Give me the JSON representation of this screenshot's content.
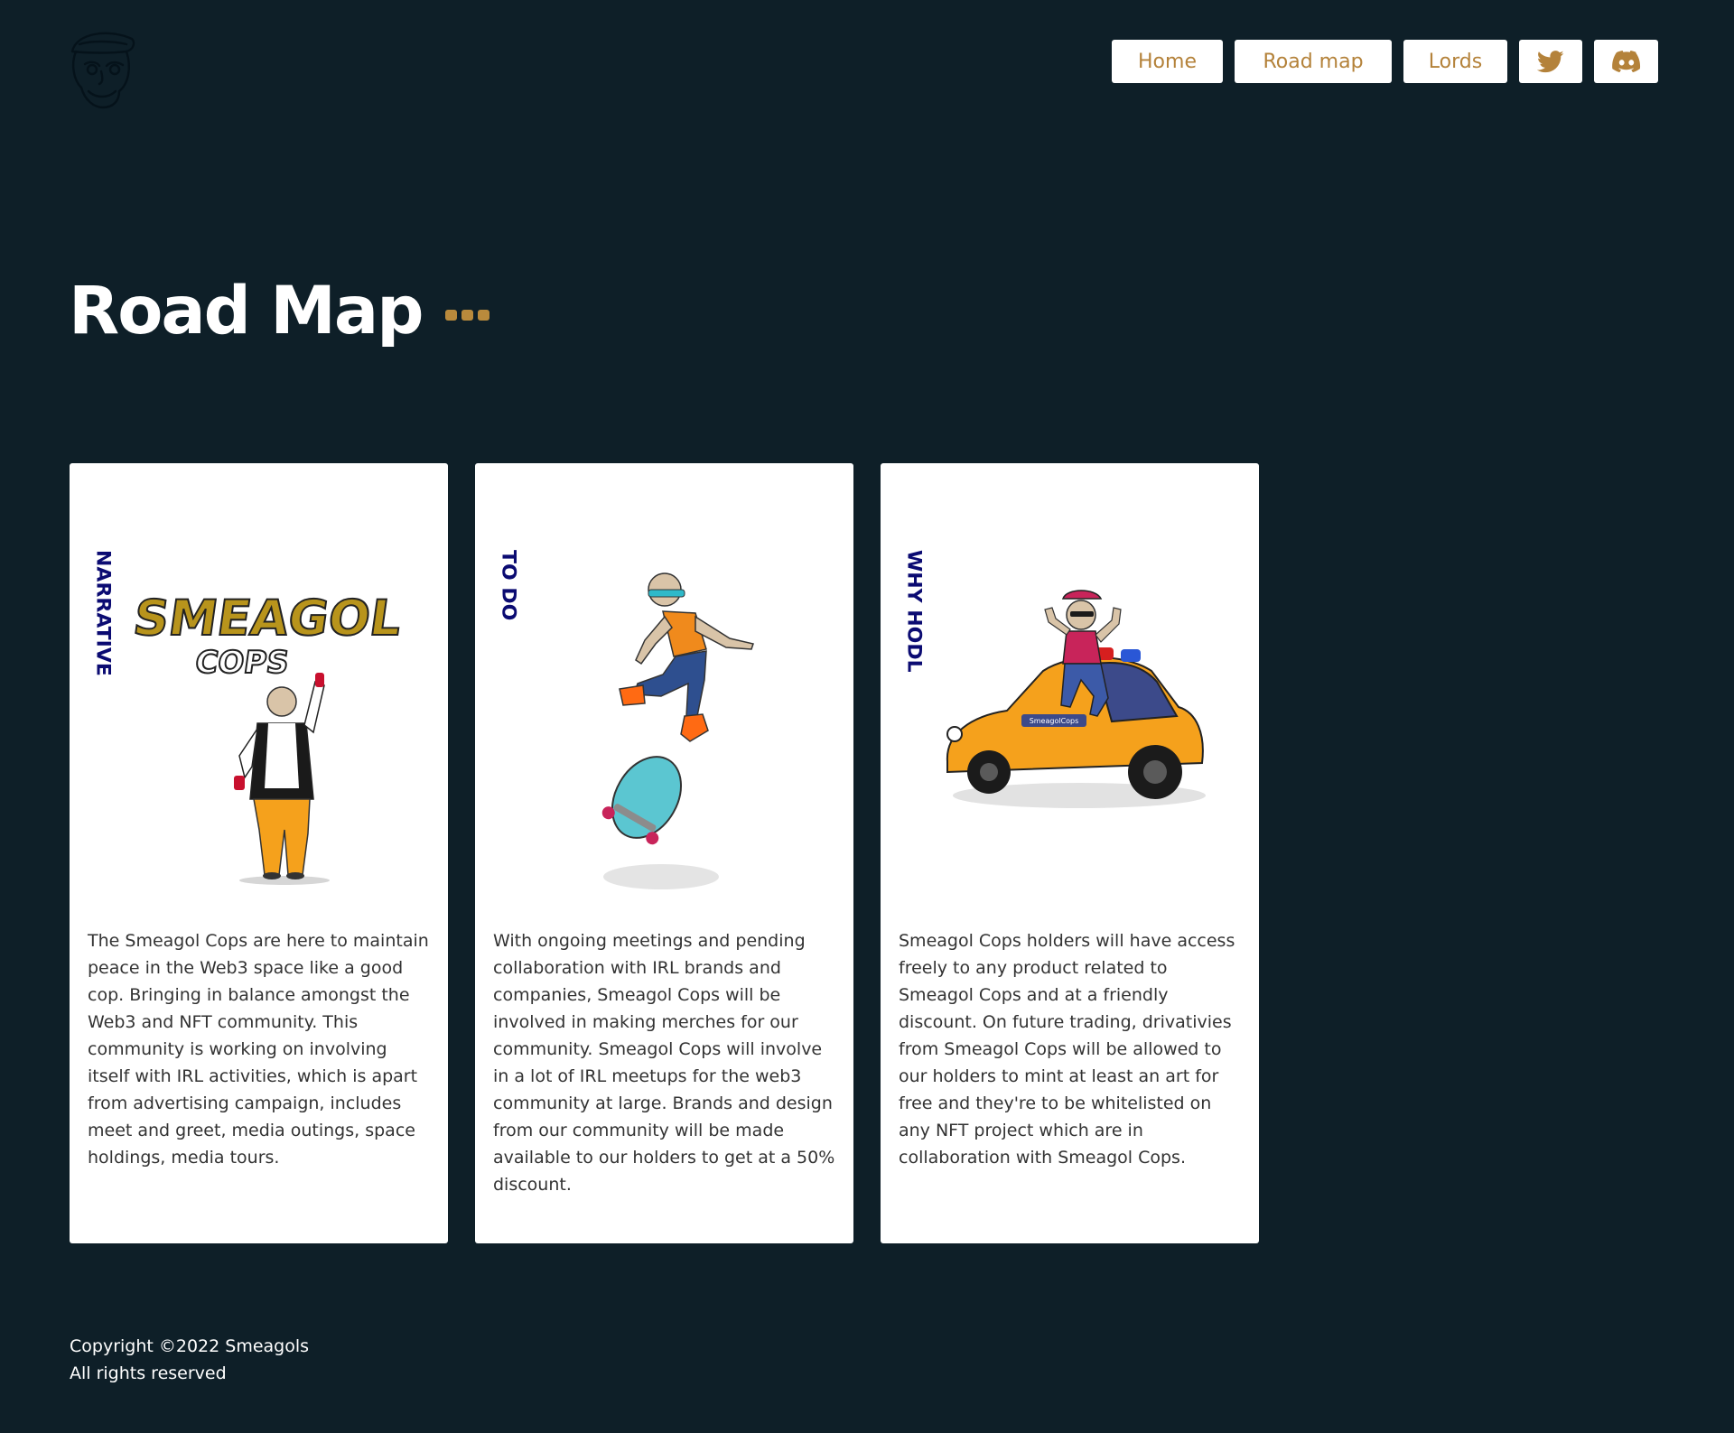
{
  "nav": {
    "home_label": "Home",
    "roadmap_label": "Road map",
    "lords_label": "Lords"
  },
  "page": {
    "title": "Road Map"
  },
  "cards": [
    {
      "label": "NARRATIVE",
      "text": "The Smeagol Cops are here to maintain peace in the Web3 space like a good cop. Bringing in balance amongst the Web3 and NFT community. This community is working on involving itself with IRL activities, which is apart from advertising campaign, includes meet and greet, media outings, space holdings, media tours."
    },
    {
      "label": "TO DO",
      "text": "With ongoing meetings and pending collaboration with IRL brands and companies, Smeagol Cops will be involved in making merches for our community. Smeagol Cops will involve in a lot of IRL meetups for the web3 community at large. Brands and design from our community will be made available to our holders to get at a 50% discount."
    },
    {
      "label": "WHY HODL",
      "text": "Smeagol Cops holders will have access freely to any product related to Smeagol Cops and at a friendly discount. On future trading, drivativies from Smeagol Cops will be allowed to our holders to mint at least an art for free and they're to be whitelisted on any NFT project which are in collaboration with Smeagol Cops."
    }
  ],
  "art": {
    "graffiti_text": "SMEAGOL",
    "graffiti_subtext": "COPS",
    "car_plate": "SmeagolCops"
  },
  "footer": {
    "copyright": "Copyright ©2022 Smeagols",
    "rights": "All rights reserved"
  },
  "colors": {
    "background": "#0e1f28",
    "accent": "#b4823a",
    "card_label": "#0b0b72"
  },
  "icons": {
    "logo": "smeagol-cop-logo-icon",
    "twitter": "twitter-icon",
    "discord": "discord-icon"
  }
}
